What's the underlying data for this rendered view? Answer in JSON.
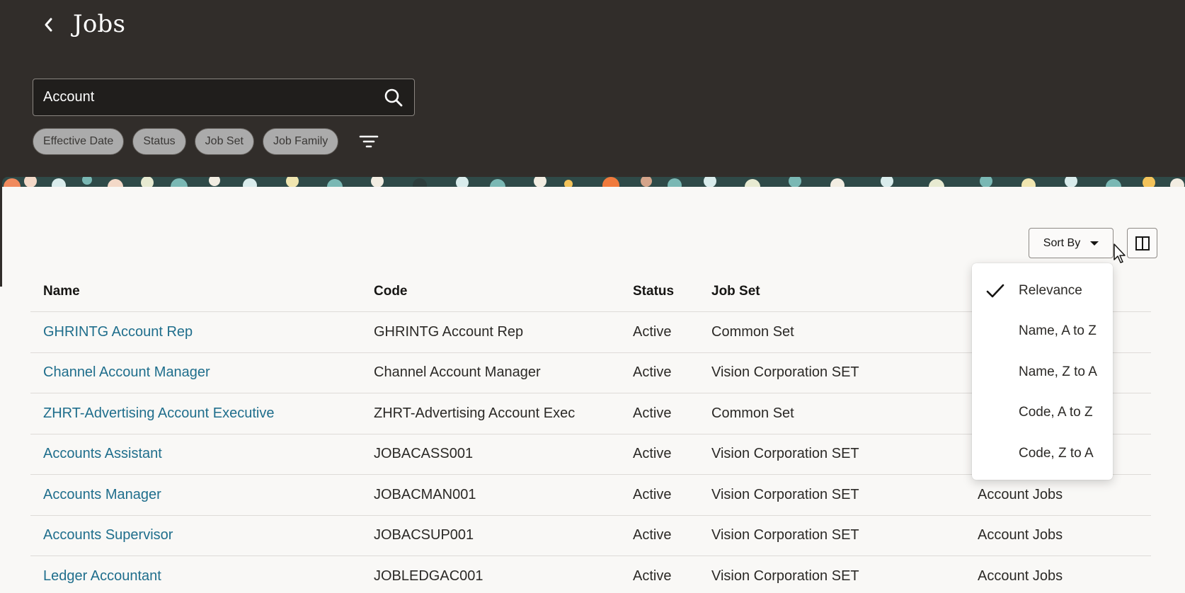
{
  "header": {
    "title": "Jobs",
    "back_icon": "chevron-left-icon"
  },
  "search": {
    "value": "Account",
    "icon": "search-icon"
  },
  "chips": [
    {
      "label": "Effective Date"
    },
    {
      "label": "Status"
    },
    {
      "label": "Job Set"
    },
    {
      "label": "Job Family"
    }
  ],
  "filter_icon": "filter-icon",
  "toolbar": {
    "sort_label": "Sort By",
    "panel_icon": "split-panel-icon"
  },
  "sort_menu": {
    "selected": "Relevance",
    "items": [
      {
        "label": "Relevance"
      },
      {
        "label": "Name, A to Z"
      },
      {
        "label": "Name, Z to A"
      },
      {
        "label": "Code, A to Z"
      },
      {
        "label": "Code, Z to A"
      }
    ]
  },
  "table": {
    "columns": {
      "name": "Name",
      "code": "Code",
      "status": "Status",
      "job_set": "Job Set"
    },
    "rows": [
      {
        "name": "GHRINTG Account Rep",
        "code": "GHRINTG Account Rep",
        "status": "Active",
        "job_set": "Common Set",
        "job_family": ""
      },
      {
        "name": "Channel Account Manager",
        "code": "Channel Account Manager",
        "status": "Active",
        "job_set": "Vision Corporation SET",
        "job_family": ""
      },
      {
        "name": "ZHRT-Advertising Account Executive",
        "code": "ZHRT-Advertising Account Exec",
        "status": "Active",
        "job_set": "Common Set",
        "job_family": ""
      },
      {
        "name": "Accounts Assistant",
        "code": "JOBACASS001",
        "status": "Active",
        "job_set": "Vision Corporation SET",
        "job_family": ""
      },
      {
        "name": "Accounts Manager",
        "code": "JOBACMAN001",
        "status": "Active",
        "job_set": "Vision Corporation SET",
        "job_family": "Account Jobs"
      },
      {
        "name": "Accounts Supervisor",
        "code": "JOBACSUP001",
        "status": "Active",
        "job_set": "Vision Corporation SET",
        "job_family": "Account Jobs"
      },
      {
        "name": "Ledger Accountant",
        "code": "JOBLEDGAC001",
        "status": "Active",
        "job_set": "Vision Corporation SET",
        "job_family": "Account Jobs"
      }
    ]
  },
  "colors": {
    "header_bg": "#312d2a",
    "link": "#1f6e8c",
    "chip_bg": "#ababab",
    "panel_bg": "#f9f8f6"
  }
}
